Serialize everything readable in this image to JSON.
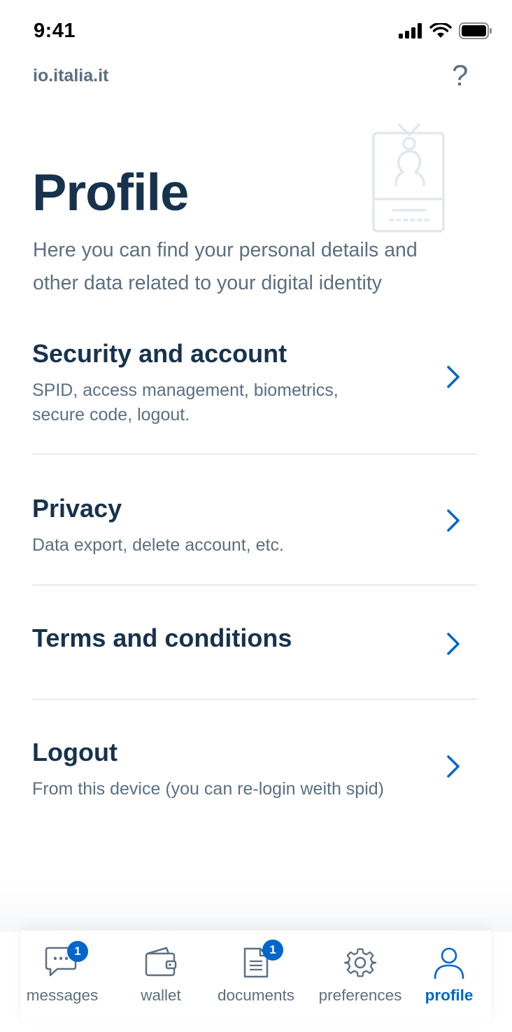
{
  "status_bar": {
    "time": "9:41"
  },
  "header": {
    "title": "io.italia.it",
    "help_glyph": "?"
  },
  "page": {
    "title": "Profile",
    "subtitle": "Here you can find your personal details and other data related to your digital identity"
  },
  "menu": [
    {
      "title": "Security and account",
      "description": "SPID, access management,  biometrics, secure code, logout."
    },
    {
      "title": "Privacy",
      "description": "Data export, delete account, etc."
    },
    {
      "title": "Terms and conditions",
      "description": ""
    },
    {
      "title": "Logout",
      "description": "From this device (you can re-login weith spid)"
    }
  ],
  "tabs": [
    {
      "label": "messages",
      "icon": "chat-bubble-icon",
      "badge": "1"
    },
    {
      "label": "wallet",
      "icon": "wallet-icon",
      "badge": ""
    },
    {
      "label": "documents",
      "icon": "document-icon",
      "badge": "1"
    },
    {
      "label": "preferences",
      "icon": "gear-icon",
      "badge": ""
    },
    {
      "label": "profile",
      "icon": "user-icon",
      "badge": "",
      "active": true
    }
  ],
  "colors": {
    "primary": "#0066cc",
    "text_dark": "#17324d",
    "text_muted": "#5c6f82",
    "divider": "#e6e9f2"
  }
}
